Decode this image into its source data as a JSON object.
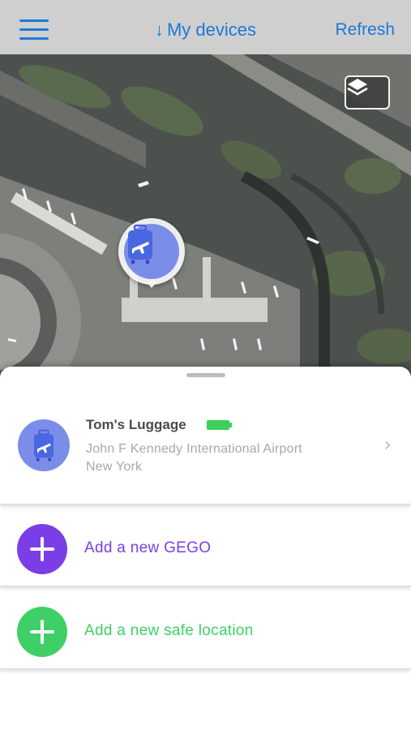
{
  "nav": {
    "menu_icon": "hamburger-menu-icon",
    "title_arrow": "↓",
    "title": "My devices",
    "refresh": "Refresh",
    "accent": "#1b79d6"
  },
  "map": {
    "layer_icon": "layers-icon",
    "marker_icon": "luggage-plane-icon"
  },
  "devices": [
    {
      "name": "Tom's Luggage",
      "battery_icon": "battery-full-icon",
      "location_line1": "John F Kennedy International Airport",
      "location_line2": "New York",
      "icon": "luggage-plane-icon"
    }
  ],
  "actions": {
    "add_gego": {
      "label": "Add a new GEGO",
      "color": "#7b3ee6",
      "icon": "plus-icon"
    },
    "add_safe_location": {
      "label": "Add a new safe location",
      "color": "#3ed067",
      "icon": "plus-icon"
    }
  }
}
